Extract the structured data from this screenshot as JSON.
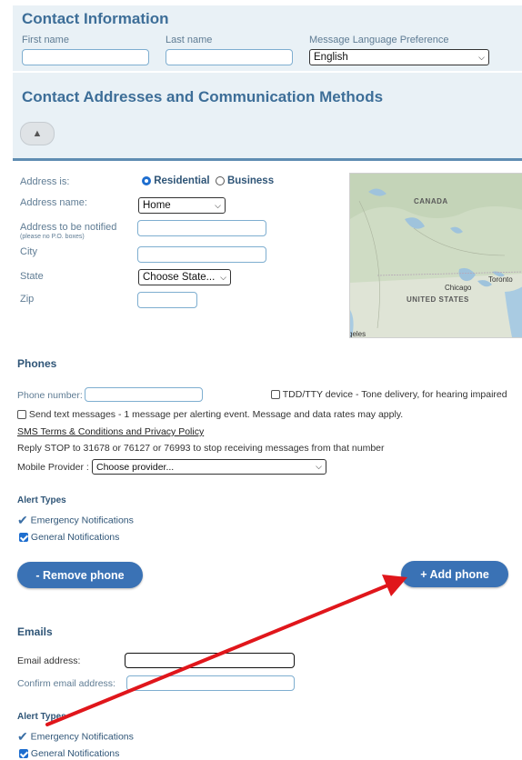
{
  "contact": {
    "title": "Contact Information",
    "first_name_label": "First name",
    "last_name_label": "Last name",
    "language_label": "Message Language Preference",
    "language_value": "English"
  },
  "addresses": {
    "title": "Contact Addresses and Communication Methods",
    "address_is_label": "Address is:",
    "residential_label": "Residential",
    "business_label": "Business",
    "address_name_label": "Address name:",
    "address_name_value": "Home",
    "notify_label": "Address to be notified",
    "notify_note": "(please no P.O. boxes)",
    "city_label": "City",
    "state_label": "State",
    "state_value": "Choose State...",
    "zip_label": "Zip"
  },
  "map": {
    "label_canada": "CANADA",
    "label_us": "UNITED STATES",
    "label_toronto": "Toronto",
    "label_chicago": "Chicago",
    "label_partial": "geles"
  },
  "phones": {
    "title": "Phones",
    "phone_label": "Phone number:",
    "tdd_label": "TDD/TTY device - Tone delivery, for hearing impaired",
    "sms_label": "Send text messages - 1 message per alerting event. Message and data rates may apply.",
    "terms_link": "SMS Terms & Conditions and Privacy Policy",
    "stop_text": "Reply STOP to 31678 or 76127 or 76993 to stop receiving messages from that number",
    "provider_label": "Mobile Provider :",
    "provider_value": "Choose provider...",
    "alert_types_title": "Alert Types",
    "emergency_label": "Emergency Notifications",
    "general_label": "General Notifications",
    "remove_button": "- Remove phone",
    "add_button": "+ Add phone"
  },
  "emails": {
    "title": "Emails",
    "email_label": "Email address:",
    "confirm_label": "Confirm email address:",
    "alert_types_title": "Alert Types",
    "emergency_label": "Emergency Notifications",
    "general_label": "General Notifications"
  },
  "colors": {
    "header_text": "#3d6e98",
    "band": "#e9f1f6",
    "button": "#3a72b5",
    "arrow": "#e0161b"
  }
}
